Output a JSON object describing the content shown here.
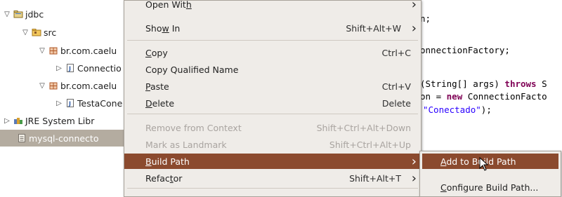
{
  "tree": {
    "items": [
      {
        "label": "jdbc",
        "twisty": "▽",
        "icon": "project-folder-icon"
      },
      {
        "label": "src",
        "twisty": "▽",
        "icon": "source-folder-icon"
      },
      {
        "label": "br.com.caelu",
        "twisty": "▽",
        "icon": "package-icon"
      },
      {
        "label": "Connectio",
        "twisty": "▷",
        "icon": "java-file-icon"
      },
      {
        "label": "br.com.caelu",
        "twisty": "▽",
        "icon": "package-icon"
      },
      {
        "label": "TestaCone",
        "twisty": "▷",
        "icon": "java-file-icon"
      },
      {
        "label": "JRE System Libr",
        "twisty": "▷",
        "icon": "library-icon"
      },
      {
        "label": "mysql-connecto",
        "twisty": "",
        "icon": "jar-file-icon",
        "selected": true
      }
    ]
  },
  "editor": {
    "lines": [
      {
        "parts": [
          {
            "t": "n;",
            "c": ""
          }
        ]
      },
      {
        "parts": [
          {
            "t": "onnectionFactory;",
            "c": ""
          }
        ]
      },
      {
        "parts": [
          {
            "t": "(String[] args) ",
            "c": ""
          },
          {
            "t": "throws",
            "c": "kw"
          },
          {
            "t": " S",
            "c": ""
          }
        ]
      },
      {
        "parts": [
          {
            "t": "on = ",
            "c": ""
          },
          {
            "t": "new",
            "c": "kw"
          },
          {
            "t": " ConnectionFacto",
            "c": ""
          }
        ]
      },
      {
        "parts": [
          {
            "t": "\"Conectado\"",
            "c": "str"
          },
          {
            "t": ");",
            "c": ""
          }
        ]
      }
    ]
  },
  "context_menu": {
    "items": [
      {
        "pre": "Open Wit",
        "u": "h",
        "post": "",
        "accel": "",
        "submenu": true,
        "disabled": false
      },
      {
        "pre": "Sho",
        "u": "w",
        "post": " In",
        "accel": "Shift+Alt+W",
        "submenu": true,
        "disabled": false
      },
      {
        "pre": "",
        "u": "C",
        "post": "opy",
        "accel": "Ctrl+C",
        "submenu": false,
        "disabled": false
      },
      {
        "pre": "Copy Qualified Name",
        "u": "",
        "post": "",
        "accel": "",
        "submenu": false,
        "disabled": false
      },
      {
        "pre": "",
        "u": "P",
        "post": "aste",
        "accel": "Ctrl+V",
        "submenu": false,
        "disabled": false
      },
      {
        "pre": "",
        "u": "D",
        "post": "elete",
        "accel": "Delete",
        "submenu": false,
        "disabled": false
      },
      {
        "pre": "Remove from Context",
        "u": "",
        "post": "",
        "accel": "Shift+Ctrl+Alt+Down",
        "submenu": false,
        "disabled": true
      },
      {
        "pre": "Mark as Landmark",
        "u": "",
        "post": "",
        "accel": "Shift+Ctrl+Alt+Up",
        "submenu": false,
        "disabled": true
      },
      {
        "pre": "",
        "u": "B",
        "post": "uild Path",
        "accel": "",
        "submenu": true,
        "disabled": false,
        "highlighted": true
      },
      {
        "pre": "Refac",
        "u": "t",
        "post": "or",
        "accel": "Shift+Alt+T",
        "submenu": true,
        "disabled": false
      }
    ]
  },
  "submenu": {
    "items": [
      {
        "pre": "",
        "u": "A",
        "post": "dd to Build Path",
        "highlighted": true
      },
      {
        "pre": "",
        "u": "C",
        "post": "onfigure Build Path...",
        "highlighted": false
      }
    ]
  },
  "colors": {
    "menu_highlight": "#8b4a2e",
    "selection": "#b4aca0",
    "keyword": "#7f0055",
    "string": "#2a00ff"
  }
}
